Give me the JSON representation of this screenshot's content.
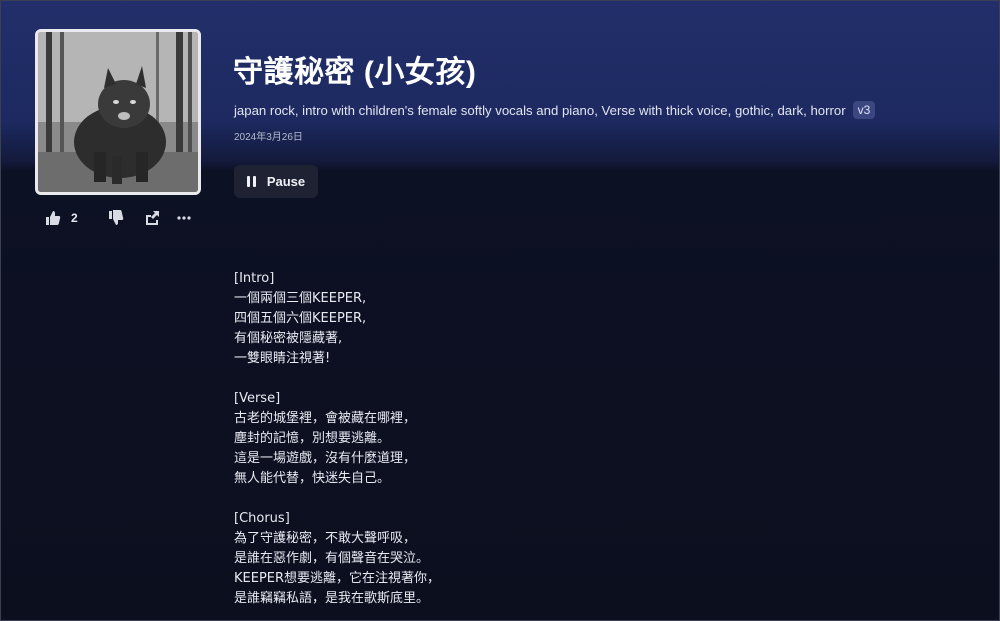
{
  "song": {
    "title": "守護秘密 (小女孩)",
    "tags": "japan rock, intro with children's female softly vocals and piano, Verse with thick voice, gothic, dark, horror",
    "version": "v3",
    "date": "2024年3月26日",
    "cover_icon": "gothic-cat-artwork"
  },
  "actions": {
    "like_count": "2",
    "icons": [
      "thumbs-up-icon",
      "thumbs-down-icon",
      "share-icon",
      "more-icon"
    ]
  },
  "player": {
    "pause_label": "Pause"
  },
  "lyrics": [
    {
      "tag": "[Intro]",
      "lines": [
        "一個兩個三個KEEPER,",
        "四個五個六個KEEPER,",
        "有個秘密被隱藏著,",
        "一雙眼睛注視著!"
      ]
    },
    {
      "tag": "[Verse]",
      "lines": [
        "古老的城堡裡，會被藏在哪裡，",
        "塵封的記憶，別想要逃離。",
        "這是一場遊戲，沒有什麼道理，",
        "無人能代替，快迷失自己。"
      ]
    },
    {
      "tag": "[Chorus]",
      "lines": [
        "為了守護秘密，不敢大聲呼吸，",
        "是誰在惡作劇，有個聲音在哭泣。",
        "KEEPER想要逃離，它在注視著你，",
        "是誰竊竊私語，是我在歌斯底里。"
      ]
    }
  ],
  "colors": {
    "header_blue": "#222f6a",
    "background": "#0b0f1e",
    "button": "#1e2233"
  }
}
